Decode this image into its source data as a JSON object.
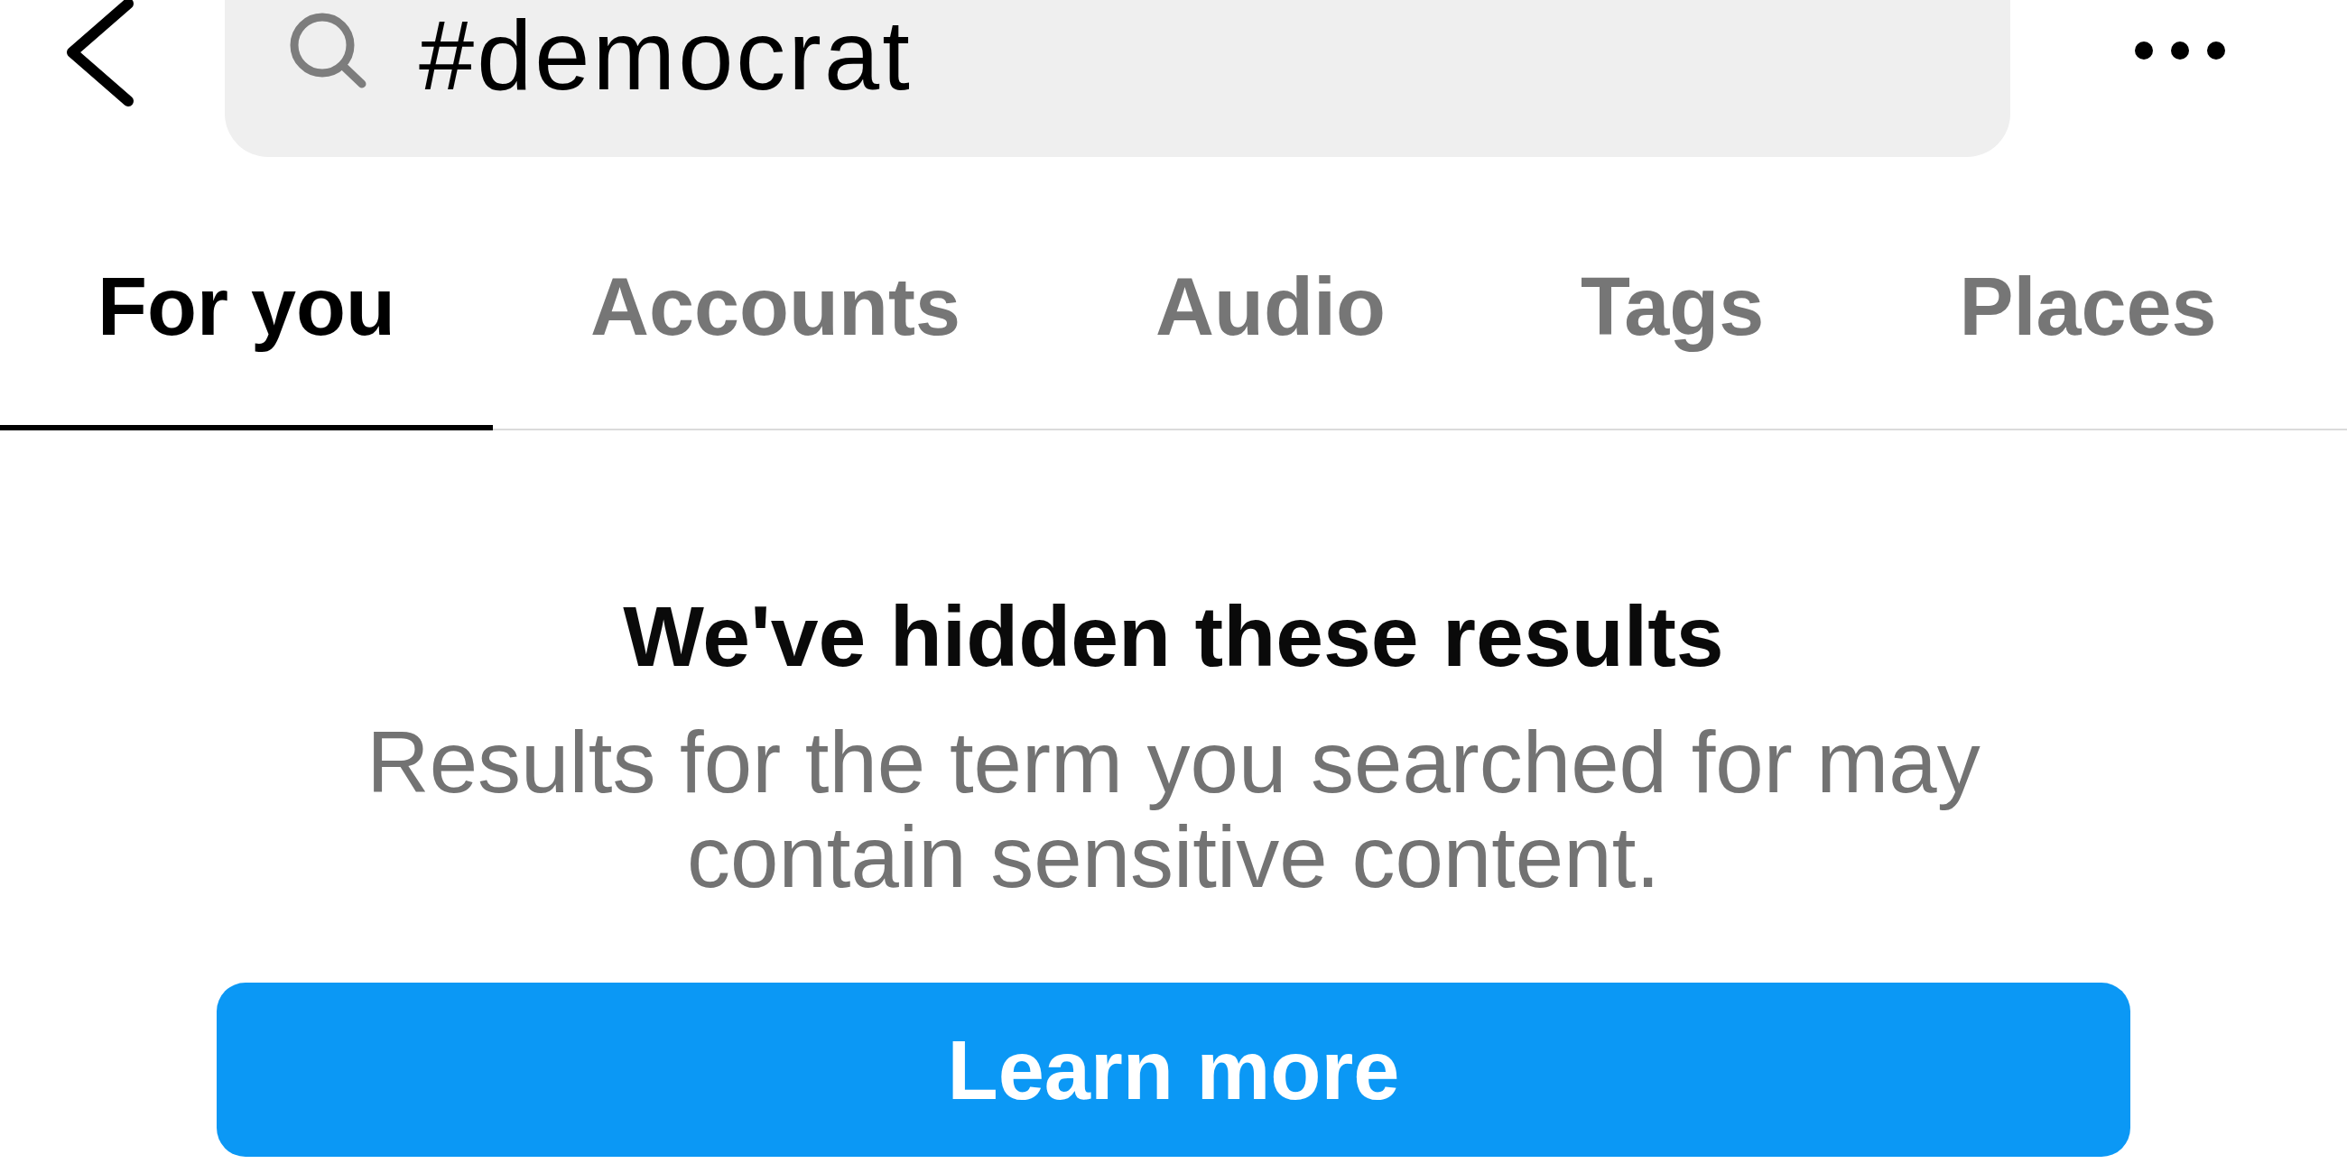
{
  "header": {
    "search": {
      "value": "#democrat"
    }
  },
  "tabs": [
    {
      "label": "For you",
      "selected": true
    },
    {
      "label": "Accounts",
      "selected": false
    },
    {
      "label": "Audio",
      "selected": false
    },
    {
      "label": "Tags",
      "selected": false
    },
    {
      "label": "Places",
      "selected": false
    }
  ],
  "notice": {
    "title": "We've hidden these results",
    "message": "Results for the term you searched for may contain sensitive content.",
    "button": "Learn more"
  }
}
